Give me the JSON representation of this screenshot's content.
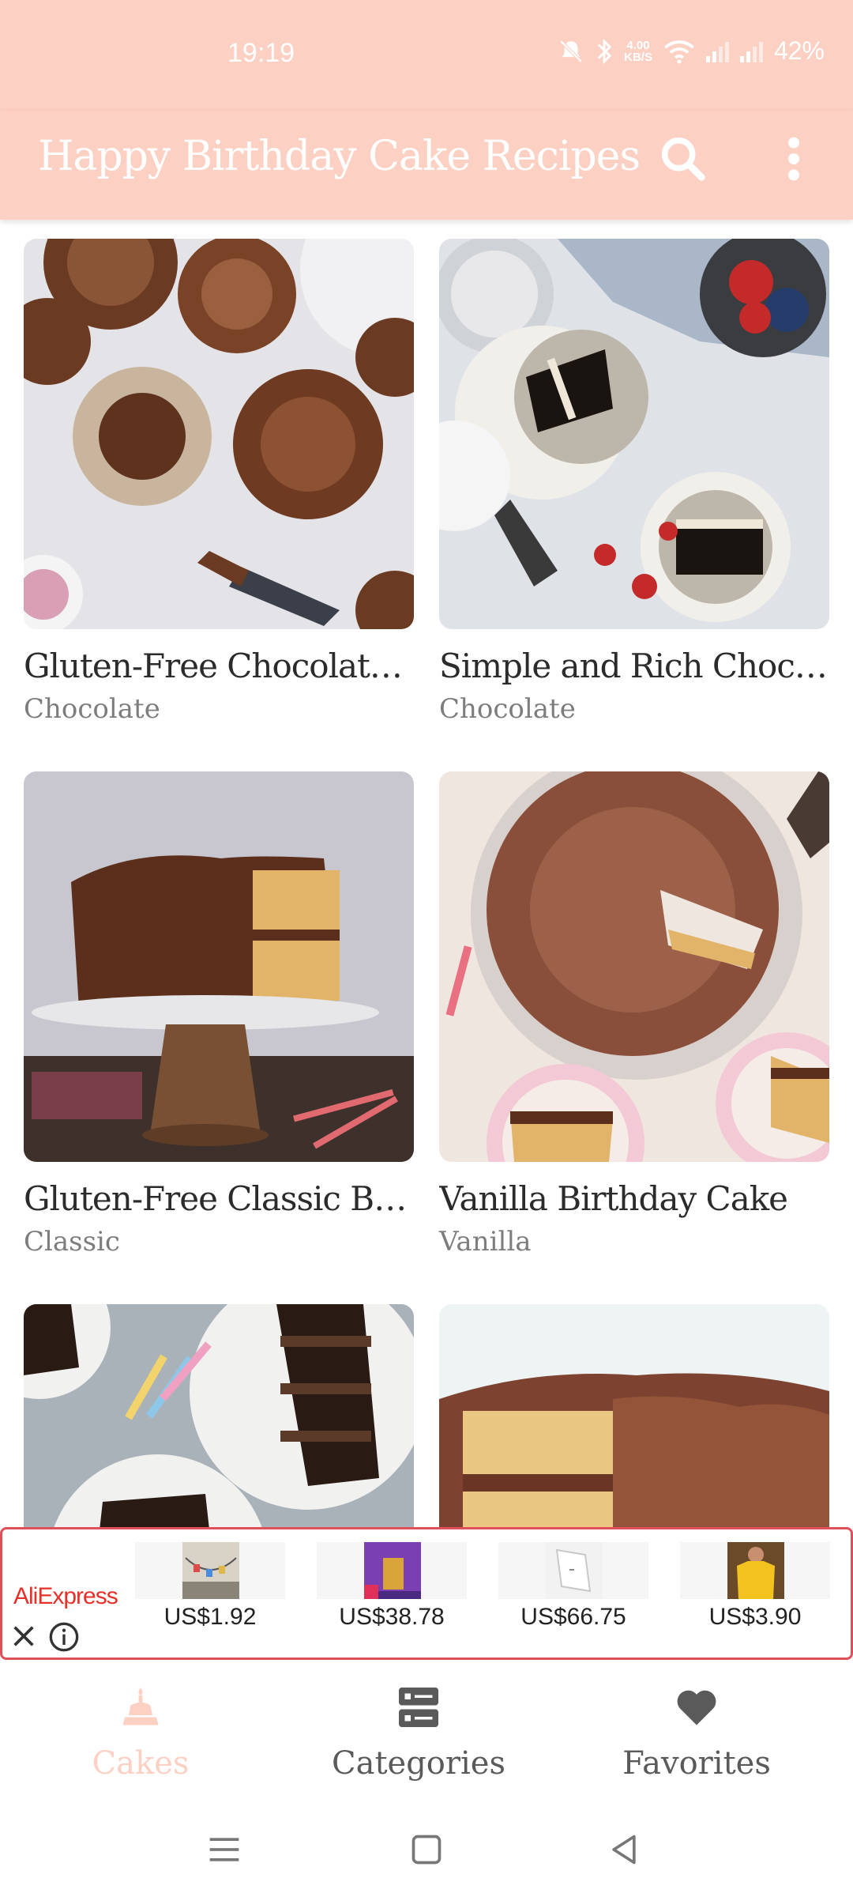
{
  "status_bar": {
    "time": "19:19",
    "speed_value": "4.00",
    "speed_unit": "KB/S",
    "battery": "42%"
  },
  "app_bar": {
    "title": "Happy Birthday Cake Recipes",
    "icons": [
      "search-icon",
      "more-vert-icon"
    ]
  },
  "recipes": [
    {
      "title": "Gluten-Free Chocolate ...",
      "category": "Chocolate"
    },
    {
      "title": "Simple and Rich Chocol...",
      "category": "Chocolate"
    },
    {
      "title": "Gluten-Free Classic Birt...",
      "category": "Classic"
    },
    {
      "title": "Vanilla Birthday Cake",
      "category": "Vanilla"
    },
    {
      "title": "",
      "category": ""
    },
    {
      "title": "",
      "category": ""
    }
  ],
  "ad": {
    "brand": "AliExpress",
    "items": [
      {
        "price": "US$1.92"
      },
      {
        "price": "US$38.78"
      },
      {
        "price": "US$66.75"
      },
      {
        "price": "US$3.90"
      }
    ]
  },
  "bottom_nav": {
    "items": [
      {
        "label": "Cakes",
        "icon": "cake-icon",
        "active": true
      },
      {
        "label": "Categories",
        "icon": "categories-icon",
        "active": false
      },
      {
        "label": "Favorites",
        "icon": "heart-icon",
        "active": false
      }
    ]
  },
  "colors": {
    "primary": "#fdd0c4",
    "ad_border": "#e0505a",
    "ad_brand": "#e4322a",
    "nav_inactive": "#5a5a5a",
    "title_text": "#2b2b2b",
    "subtitle_text": "#7d7d7d"
  }
}
